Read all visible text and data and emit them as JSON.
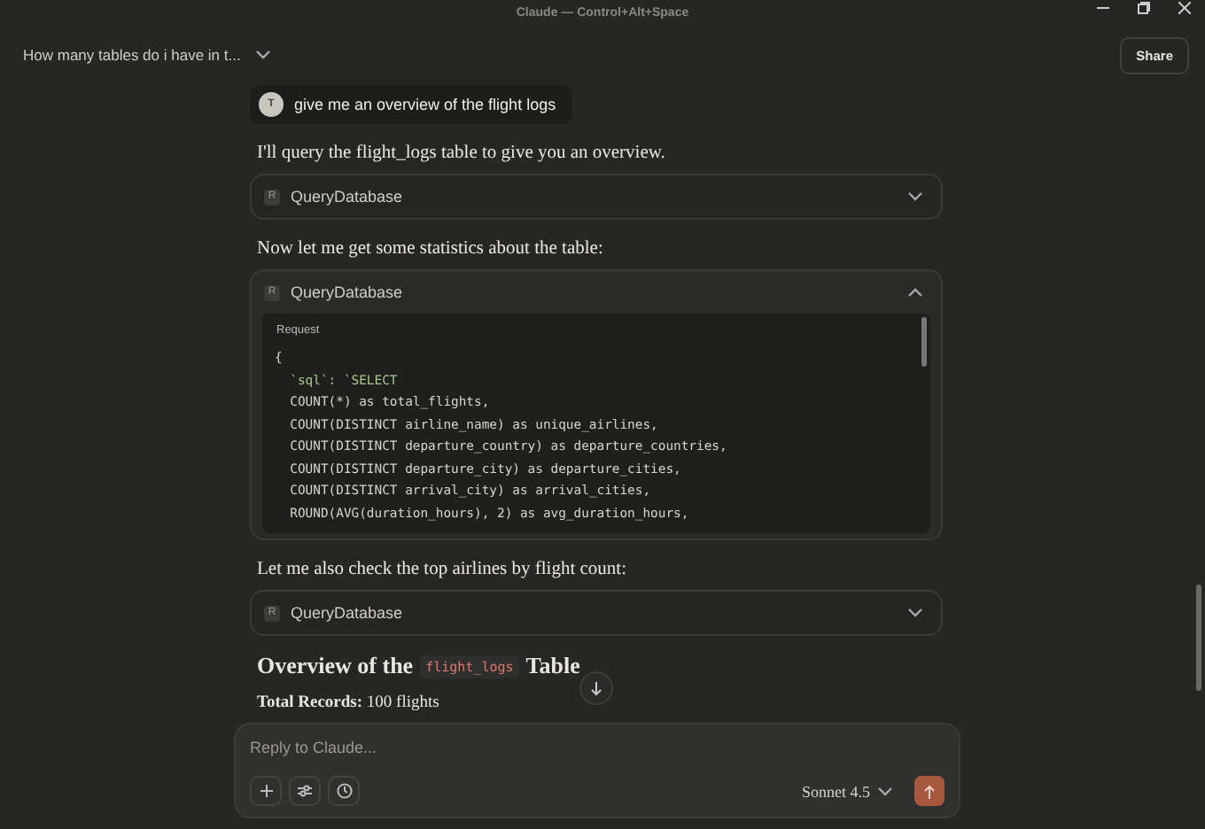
{
  "window": {
    "title": "Claude — Control+Alt+Space"
  },
  "header": {
    "conversation_title": "How many tables do i have in t...",
    "share": "Share"
  },
  "messages": [
    {
      "kind": "user",
      "avatar": "T",
      "text": "give me an overview of the flight logs"
    },
    {
      "kind": "text",
      "text": "I'll query the flight_logs table to give you an overview."
    },
    {
      "kind": "tool",
      "badge": "R",
      "name": "QueryDatabase",
      "expanded": false
    },
    {
      "kind": "text",
      "text": "Now let me get some statistics about the table:"
    },
    {
      "kind": "tool",
      "badge": "R",
      "name": "QueryDatabase",
      "expanded": true,
      "request_label": "Request",
      "code_lines": [
        {
          "kind": "plain",
          "text": "{"
        },
        {
          "kind": "string",
          "text": "  `sql`: `SELECT"
        },
        {
          "kind": "plain",
          "text": "  COUNT(*) as total_flights,"
        },
        {
          "kind": "plain",
          "text": "  COUNT(DISTINCT airline_name) as unique_airlines,"
        },
        {
          "kind": "plain",
          "text": "  COUNT(DISTINCT departure_country) as departure_countries,"
        },
        {
          "kind": "plain",
          "text": "  COUNT(DISTINCT departure_city) as departure_cities,"
        },
        {
          "kind": "plain",
          "text": "  COUNT(DISTINCT arrival_city) as arrival_cities,"
        },
        {
          "kind": "plain",
          "text": "  ROUND(AVG(duration_hours), 2) as avg_duration_hours,"
        }
      ]
    },
    {
      "kind": "text",
      "text": "Let me also check the top airlines by flight count:"
    },
    {
      "kind": "tool",
      "badge": "R",
      "name": "QueryDatabase",
      "expanded": false
    },
    {
      "kind": "heading",
      "parts": [
        {
          "kind": "text",
          "text": "Overview of the"
        },
        {
          "kind": "code",
          "text": "flight_logs"
        },
        {
          "kind": "text",
          "text": "Table"
        }
      ]
    },
    {
      "kind": "stat",
      "text": "**Total Records:** 100 flights"
    }
  ],
  "composer": {
    "placeholder": "Reply to Claude...",
    "model": "Sonnet 4.5"
  }
}
